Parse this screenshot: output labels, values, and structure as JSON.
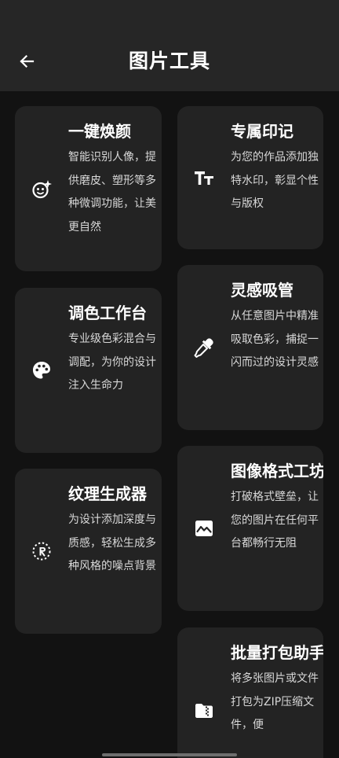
{
  "header": {
    "title": "图片工具",
    "back_icon": "arrow-left-icon"
  },
  "colors": {
    "background": "#121212",
    "header": "#262626",
    "card": "#232323",
    "text_primary": "#ffffff",
    "text_secondary": "#d8d8d8"
  },
  "tools": [
    {
      "title": "一键焕颜",
      "description": "智能识别人像，提供磨皮、塑形等多种微调功能，让美更自然",
      "icon": "face-sparkle-icon"
    },
    {
      "title": "专属印记",
      "description": "为您的作品添加独特水印，彰显个性与版权",
      "icon": "text-size-icon"
    },
    {
      "title": "调色工作台",
      "description": "专业级色彩混合与调配，为你的设计注入生命力",
      "icon": "palette-icon"
    },
    {
      "title": "灵感吸管",
      "description": "从任意图片中精准吸取色彩，捕捉一闪而过的设计灵感",
      "icon": "eyedropper-icon"
    },
    {
      "title": "纹理生成器",
      "description": "为设计添加深度与质感，轻松生成多种风格的噪点背景",
      "icon": "texture-icon"
    },
    {
      "title": "图像格式工坊",
      "description": "打破格式壁垒，让您的图片在任何平台都畅行无阻",
      "icon": "image-icon"
    },
    {
      "title": "批量打包助手",
      "description": "将多张图片或文件打包为ZIP压缩文件，便",
      "icon": "zip-folder-icon"
    }
  ]
}
